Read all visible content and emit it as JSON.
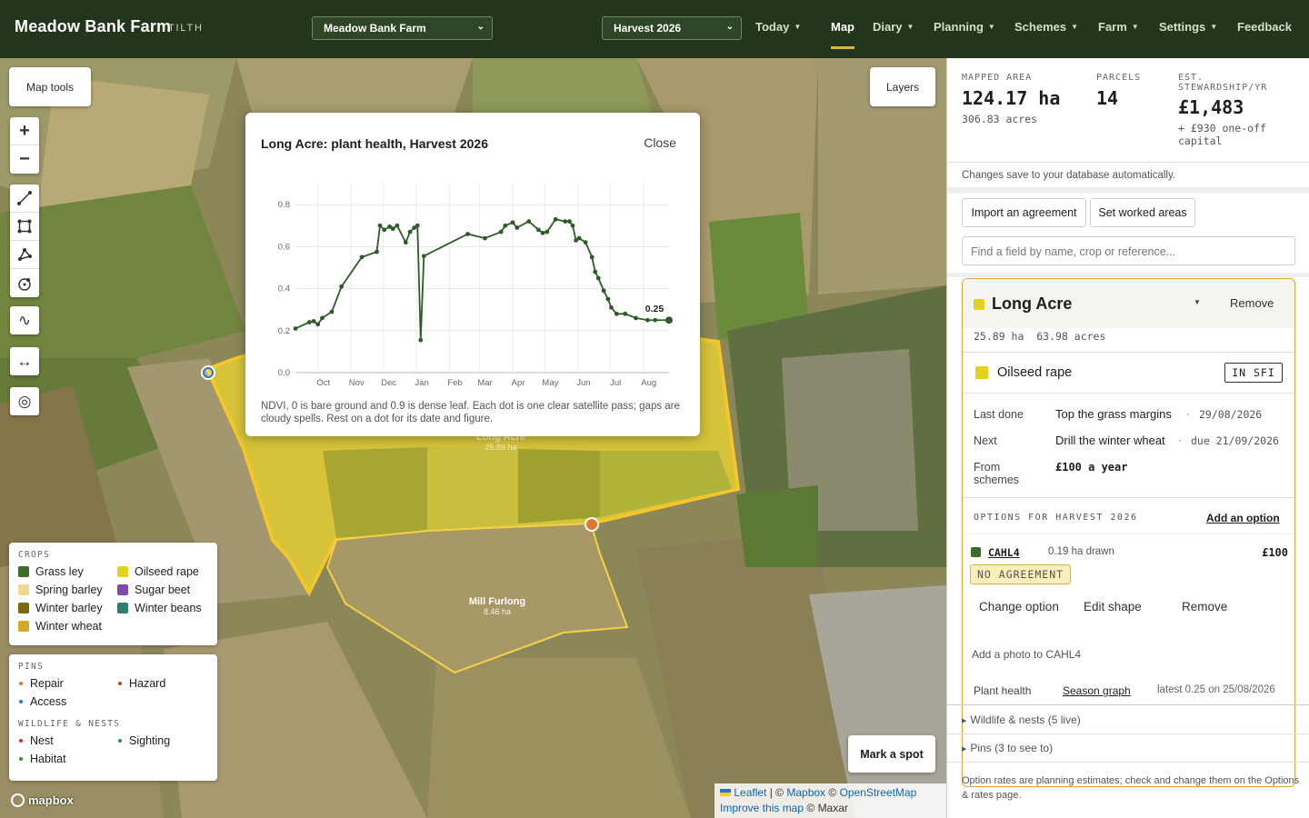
{
  "app": {
    "title": "Meadow Bank Farm",
    "subtitle": "TILTH"
  },
  "farm_select": {
    "value": "Meadow Bank Farm"
  },
  "harvest_select": {
    "value": "Harvest 2026"
  },
  "nav": {
    "today": "Today",
    "map": "Map",
    "diary": "Diary",
    "planning": "Planning",
    "schemes": "Schemes",
    "farm": "Farm",
    "settings": "Settings",
    "feedback": "Feedback"
  },
  "map": {
    "tools_label": "Map tools",
    "layers_label": "Layers",
    "mark_spot": "Mark a spot",
    "fields": [
      {
        "name": "Long Acre",
        "area": "25.89 ha"
      },
      {
        "name": "Mill Furlong",
        "area": "8.46 ha"
      }
    ],
    "legend": {
      "crops_title": "CROPS",
      "crops": [
        {
          "name": "Grass ley",
          "color": "#3c6b2a"
        },
        {
          "name": "Oilseed rape",
          "color": "#e3d21b"
        },
        {
          "name": "Spring barley",
          "color": "#f0d98a"
        },
        {
          "name": "Sugar beet",
          "color": "#7d4aa6"
        },
        {
          "name": "Winter barley",
          "color": "#7a6a14"
        },
        {
          "name": "Winter beans",
          "color": "#2f7f6f"
        },
        {
          "name": "Winter wheat",
          "color": "#d6a826"
        }
      ],
      "pins_title": "PINS",
      "pins": [
        {
          "name": "Repair",
          "color": "#e07a2a"
        },
        {
          "name": "Hazard",
          "color": "#c43a2e"
        },
        {
          "name": "Access",
          "color": "#2e78c4"
        }
      ],
      "wildlife_title": "WILDLIFE & NESTS",
      "wildlife": [
        {
          "name": "Nest",
          "color": "#c43a2e"
        },
        {
          "name": "Sighting",
          "color": "#2e78c4"
        },
        {
          "name": "Habitat",
          "color": "#3c8a3a"
        }
      ]
    },
    "attribution": {
      "leaflet": "Leaflet",
      "mapbox": "Mapbox",
      "osm": "OpenStreetMap",
      "improve": "Improve this map",
      "maxar": "Maxar"
    },
    "mapbox_logo": "mapbox"
  },
  "popup": {
    "title": "Long Acre: plant health, Harvest 2026",
    "close": "Close",
    "caption": "NDVI, 0 is bare ground and 0.9 is dense leaf. Each dot is one clear satellite pass; gaps are cloudy spells. Rest on a dot for its date and figure.",
    "latest_label": "0.25"
  },
  "chart_data": {
    "type": "line",
    "title": "Long Acre: plant health, Harvest 2026",
    "xlabel": "",
    "ylabel": "",
    "ylim": [
      0,
      0.9
    ],
    "yticks": [
      "0.0",
      "0.2",
      "0.4",
      "0.6",
      "0.8"
    ],
    "xticks": [
      "Oct",
      "Nov",
      "Dec",
      "Jan",
      "Feb",
      "Mar",
      "Apr",
      "May",
      "Jun",
      "Jul",
      "Aug"
    ],
    "grid": true,
    "series": [
      {
        "color": "#2f5a2a",
        "x": [
          "2025-09-10",
          "2025-09-23",
          "2025-09-27",
          "2025-10-01",
          "2025-10-05",
          "2025-10-14",
          "2025-10-23",
          "2025-11-11",
          "2025-11-25",
          "2025-11-28",
          "2025-12-02",
          "2025-12-07",
          "2025-12-10",
          "2025-12-14",
          "2025-12-22",
          "2025-12-26",
          "2025-12-30",
          "2026-01-02",
          "2026-01-05",
          "2026-01-08",
          "2026-02-18",
          "2026-03-06",
          "2026-03-21",
          "2026-03-25",
          "2026-04-01",
          "2026-04-05",
          "2026-04-16",
          "2026-04-25",
          "2026-04-29",
          "2026-05-03",
          "2026-05-11",
          "2026-05-20",
          "2026-05-24",
          "2026-05-27",
          "2026-05-30",
          "2026-06-02",
          "2026-06-08",
          "2026-06-14",
          "2026-06-17",
          "2026-06-20",
          "2026-06-25",
          "2026-06-29",
          "2026-07-02",
          "2026-07-07",
          "2026-07-15",
          "2026-07-25",
          "2026-08-05",
          "2026-08-12",
          "2026-08-25"
        ],
        "y": [
          0.21,
          0.24,
          0.245,
          0.23,
          0.26,
          0.29,
          0.41,
          0.55,
          0.575,
          0.7,
          0.68,
          0.695,
          0.685,
          0.7,
          0.62,
          0.67,
          0.69,
          0.7,
          0.155,
          0.555,
          0.66,
          0.64,
          0.67,
          0.7,
          0.715,
          0.69,
          0.72,
          0.68,
          0.665,
          0.67,
          0.73,
          0.72,
          0.72,
          0.7,
          0.63,
          0.64,
          0.62,
          0.55,
          0.48,
          0.45,
          0.39,
          0.35,
          0.31,
          0.28,
          0.28,
          0.26,
          0.25,
          0.25,
          0.25
        ]
      }
    ]
  },
  "panel": {
    "stats": {
      "mapped_area_label": "MAPPED AREA",
      "mapped_area": "124.17 ha",
      "mapped_acres": "306.83 acres",
      "parcels_label": "PARCELS",
      "parcels": "14",
      "stewardship_label": "EST. STEWARDSHIP/YR",
      "stewardship": "£1,483",
      "capital": "+ £930 one-off capital"
    },
    "autosave_note": "Changes save to your database automatically.",
    "import_btn": "Import an agreement",
    "worked_btn": "Set worked areas",
    "search_placeholder": "Find a field by name, crop or reference...",
    "field": {
      "name": "Long Acre",
      "color": "#e3d21b",
      "remove": "Remove",
      "area": "25.89 ha  63.98 acres",
      "crop": "Oilseed rape",
      "scheme_badge": "IN SFI",
      "last_done_label": "Last done",
      "last_done": "Top the grass margins",
      "last_done_date": "29/08/2026",
      "next_label": "Next",
      "next": "Drill the winter wheat",
      "next_date": "due 21/09/2026",
      "from_schemes_label": "From schemes",
      "from_schemes": "£100 a year",
      "options_label": "OPTIONS FOR HARVEST 2026",
      "add_option": "Add an option",
      "option_code": "CAHL4",
      "option_area": "0.19 ha drawn",
      "option_value": "£100",
      "no_agreement": "NO AGREEMENT",
      "change_option": "Change option",
      "edit_shape": "Edit shape",
      "option_remove": "Remove",
      "add_photo": "Add a photo to CAHL4",
      "plant_health_label": "Plant health",
      "season_graph": "Season graph",
      "latest": "latest 0.25 on 25/08/2026"
    },
    "wildlife_acc": "Wildlife & nests (5 live)",
    "pins_acc": "Pins (3 to see to)",
    "footer_note": "Option rates are planning estimates; check and change them on the Options & rates page."
  }
}
